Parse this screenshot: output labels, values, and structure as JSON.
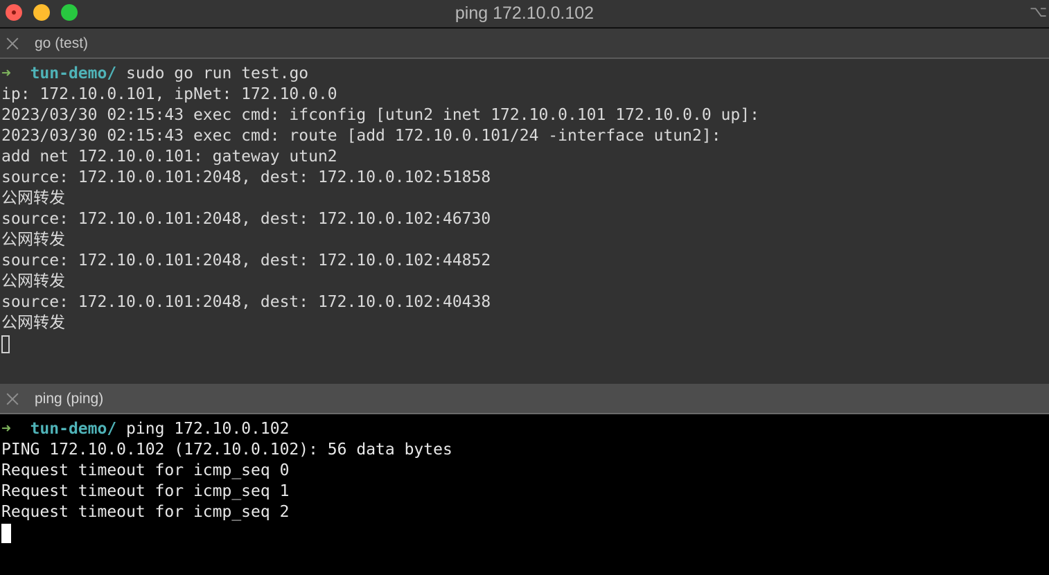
{
  "window": {
    "title": "ping 172.10.0.102",
    "right_glyph": "⌥⌘"
  },
  "top_pane": {
    "tab_label": "go (test)",
    "prompt": {
      "arrow": "➜",
      "dir": "tun-demo/",
      "command": "sudo go run test.go"
    },
    "lines": [
      "ip: 172.10.0.101, ipNet: 172.10.0.0",
      "2023/03/30 02:15:43 exec cmd: ifconfig [utun2 inet 172.10.0.101 172.10.0.0 up]:",
      "2023/03/30 02:15:43 exec cmd: route [add 172.10.0.101/24 -interface utun2]:",
      "add net 172.10.0.101: gateway utun2",
      "source: 172.10.0.101:2048, dest: 172.10.0.102:51858",
      "公网转发",
      "source: 172.10.0.101:2048, dest: 172.10.0.102:46730",
      "公网转发",
      "source: 172.10.0.101:2048, dest: 172.10.0.102:44852",
      "公网转发",
      "source: 172.10.0.101:2048, dest: 172.10.0.102:40438",
      "公网转发"
    ]
  },
  "bottom_pane": {
    "tab_label": "ping (ping)",
    "prompt": {
      "arrow": "➜",
      "dir": "tun-demo/",
      "command": "ping 172.10.0.102"
    },
    "lines": [
      "PING 172.10.0.102 (172.10.0.102): 56 data bytes",
      "Request timeout for icmp_seq 0",
      "Request timeout for icmp_seq 1",
      "Request timeout for icmp_seq 2"
    ]
  },
  "colors": {
    "prompt_arrow": "#7fb55d",
    "prompt_dir": "#4fb3b8",
    "top_pane_bg": "#323232",
    "bottom_pane_bg": "#000000"
  }
}
